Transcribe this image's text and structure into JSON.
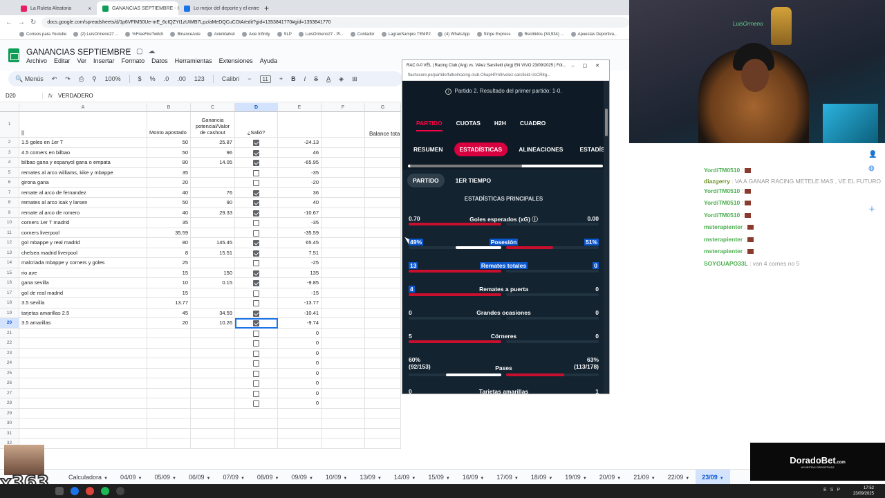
{
  "browser": {
    "tabs": [
      {
        "title": "La Ruleta Aleatoria",
        "color": "#e91e63"
      },
      {
        "title": "GANANCIAS SEPTIEMBRE - Hoj",
        "color": "#0f9d58",
        "active": true
      },
      {
        "title": "Lo mejor del deporte y el entre",
        "color": "#1a73e8"
      }
    ],
    "url": "docs.google.com/spreadsheets/d/1p6VFIM50Ue-mE_6cIQZYt1zUIMB7Lpz/aMeDQCuCOtA/edit?gid=1353841770#gid=1353841770",
    "bookmarks": [
      "Correos para Youtube",
      "(2) LuisOrmeno27 ...",
      "%FreeFireTwitch",
      "BinanceAxie",
      "AxieMarket",
      "Axie Infinity",
      "SLP",
      "LuisOrmeno27 - Pl...",
      "Contador",
      "LagranSampre TEMP2",
      "(4) WhatsApp",
      "Stripe Express",
      "Recibidos (34,934) ...",
      "Apuestas Deportiva..."
    ]
  },
  "sheets": {
    "title": "GANANCIAS SEPTIEMBRE",
    "menu": [
      "Archivo",
      "Editar",
      "Ver",
      "Insertar",
      "Formato",
      "Datos",
      "Herramientas",
      "Extensiones",
      "Ayuda"
    ],
    "toolbar": {
      "search": "Menús",
      "zoom": "100%",
      "currency": "$",
      "percent": "%",
      "dec_less": ".0",
      "dec_more": ".00",
      "format": "123",
      "font": "Calibri",
      "font_size": "11"
    },
    "cell_ref": "D20",
    "formula": "VERDADERO",
    "columns": [
      "A",
      "B",
      "C",
      "D",
      "E",
      "F",
      "G"
    ],
    "header_row": {
      "a": "||",
      "b": "Monto apostado",
      "c": "Ganancia potencial/Valor de cashout",
      "d": "¿Salió?",
      "g": "Balance tota"
    },
    "rows": [
      {
        "n": "2",
        "a": "1.5 goles en 1er T",
        "b": "50",
        "c": "25.87",
        "d": true,
        "e": "-24.13"
      },
      {
        "n": "3",
        "a": "4.5 corners en bilbao",
        "b": "50",
        "c": "96",
        "d": true,
        "e": "46"
      },
      {
        "n": "4",
        "a": "bilbao gana y espanyol gana o empata",
        "b": "80",
        "c": "14.05",
        "d": true,
        "e": "-65.95"
      },
      {
        "n": "5",
        "a": "remates al arco williams, kike y mbappe",
        "b": "35",
        "c": "",
        "d": false,
        "e": "-35"
      },
      {
        "n": "6",
        "a": "girona gana",
        "b": "20",
        "c": "",
        "d": false,
        "e": "-20"
      },
      {
        "n": "7",
        "a": "remate al arco de fernandez",
        "b": "40",
        "c": "76",
        "d": true,
        "e": "36"
      },
      {
        "n": "8",
        "a": "remates al arco isak y larsen",
        "b": "50",
        "c": "90",
        "d": true,
        "e": "40"
      },
      {
        "n": "9",
        "a": "remate al arco de romero",
        "b": "40",
        "c": "29.33",
        "d": true,
        "e": "-10.67"
      },
      {
        "n": "10",
        "a": "corners 1er T madrid",
        "b": "35",
        "c": "",
        "d": false,
        "e": "-35"
      },
      {
        "n": "11",
        "a": "corners liverpool",
        "b": "35.59",
        "c": "",
        "d": false,
        "e": "-35.59"
      },
      {
        "n": "12",
        "a": "gol mbappe y real madrid",
        "b": "80",
        "c": "145.45",
        "d": true,
        "e": "65.45"
      },
      {
        "n": "13",
        "a": "chelsea madrid liverpool",
        "b": "8",
        "c": "15.51",
        "d": true,
        "e": "7.51"
      },
      {
        "n": "14",
        "a": "malcriada mbappe y corners y goles",
        "b": "25",
        "c": "",
        "d": false,
        "e": "-25"
      },
      {
        "n": "15",
        "a": "rio ave",
        "b": "15",
        "c": "150",
        "d": true,
        "e": "135"
      },
      {
        "n": "16",
        "a": "gana sevilla",
        "b": "10",
        "c": "0.15",
        "d": true,
        "e": "-9.85"
      },
      {
        "n": "17",
        "a": "gol de real madrid",
        "b": "15",
        "c": "",
        "d": false,
        "e": "-15"
      },
      {
        "n": "18",
        "a": "3.5 sevilla",
        "b": "13.77",
        "c": "",
        "d": false,
        "e": "-13.77"
      },
      {
        "n": "19",
        "a": "tarjetas amarillas 2.5",
        "b": "45",
        "c": "34.59",
        "d": true,
        "e": "-10.41"
      },
      {
        "n": "20",
        "a": "3.5 amarillas",
        "b": "20",
        "c": "10.26",
        "d": true,
        "e": "-9.74",
        "selected": true
      },
      {
        "n": "21",
        "a": "",
        "b": "",
        "c": "",
        "d": false,
        "e": "0"
      },
      {
        "n": "22",
        "a": "",
        "b": "",
        "c": "",
        "d": false,
        "e": "0"
      },
      {
        "n": "23",
        "a": "",
        "b": "",
        "c": "",
        "d": false,
        "e": "0"
      },
      {
        "n": "24",
        "a": "",
        "b": "",
        "c": "",
        "d": false,
        "e": "0"
      },
      {
        "n": "25",
        "a": "",
        "b": "",
        "c": "",
        "d": false,
        "e": "0"
      },
      {
        "n": "26",
        "a": "",
        "b": "",
        "c": "",
        "d": false,
        "e": "0"
      },
      {
        "n": "27",
        "a": "",
        "b": "",
        "c": "",
        "d": false,
        "e": "0"
      },
      {
        "n": "28",
        "a": "",
        "b": "",
        "c": "",
        "d": false,
        "e": "0"
      },
      {
        "n": "29",
        "a": "",
        "b": "",
        "c": "",
        "d": null,
        "e": ""
      },
      {
        "n": "30",
        "a": "",
        "b": "",
        "c": "",
        "d": null,
        "e": ""
      },
      {
        "n": "31",
        "a": "",
        "b": "",
        "c": "",
        "d": null,
        "e": ""
      },
      {
        "n": "32",
        "a": "",
        "b": "",
        "c": "",
        "d": null,
        "e": ""
      },
      {
        "n": "33",
        "a": "",
        "b": "",
        "c": "",
        "d": null,
        "e": ""
      }
    ],
    "sheet_tabs": [
      "Calculadora",
      "04/09",
      "05/09",
      "06/09",
      "07/09",
      "08/09",
      "09/09",
      "10/09",
      "13/09",
      "14/09",
      "15/09",
      "16/09",
      "17/09",
      "18/09",
      "19/09",
      "20/09",
      "21/09",
      "22/09",
      "23/09"
    ],
    "active_tab": "23/09"
  },
  "popup": {
    "title": "RAC 0-0 VÉL | Racing Club (Arg) vs. Vélez Sarsfield (Arg) EN VIVO 23/09/2025 | Fút...",
    "url": "flashscore.pe/partido/futbol/racing-club-OhapHPm9/velez-sarsfield-UsCR8g...",
    "info": "Partido 2. Resultado del primer partido: 1-0.",
    "main_tabs": [
      "PARTIDO",
      "CUOTAS",
      "H2H",
      "CUADRO"
    ],
    "sub_tabs": [
      "RESUMEN",
      "ESTADÍSTICAS",
      "ALINEACIONES",
      "ESTADÍS"
    ],
    "period_tabs": [
      "PARTIDO",
      "1ER TIEMPO"
    ],
    "section_title": "ESTADÍSTICAS PRINCIPALES",
    "stats": [
      {
        "name": "Goles esperados (xG)",
        "left": "0.70",
        "right": "0.00",
        "lf": 1.0,
        "rf": 0.0,
        "info": true
      },
      {
        "name": "Posesión",
        "left": "49%",
        "right": "51%",
        "lf": 0.49,
        "rf": 0.51,
        "white": true,
        "hl": true
      },
      {
        "name": "Remates totales",
        "left": "13",
        "right": "0",
        "lf": 1.0,
        "rf": 0.0,
        "hl": true
      },
      {
        "name": "Remates a puerta",
        "left": "4",
        "right": "0",
        "lf": 1.0,
        "rf": 0.0,
        "hlLeft": true
      },
      {
        "name": "Grandes ocasiones",
        "left": "0",
        "right": "0",
        "lf": 0.0,
        "rf": 0.0
      },
      {
        "name": "Córneres",
        "left": "5",
        "right": "0",
        "lf": 1.0,
        "rf": 0.0
      },
      {
        "name": "Pases",
        "left": "60%",
        "left2": "(92/153)",
        "right": "63%",
        "right2": "(113/178)",
        "lf": 0.6,
        "rf": 0.63,
        "white": true
      },
      {
        "name": "Tarjetas amarillas",
        "left": "0",
        "right": "1",
        "lf": 0.0,
        "rf": 1.0
      }
    ]
  },
  "chat": [
    {
      "user": "YordiTM0510",
      "text": ":",
      "emote": true
    },
    {
      "user": "diazgerry",
      "text": ": VA A GANAR RACING METELE MAS , VE EL FUTURO"
    },
    {
      "user": "YordiTM0510",
      "text": ":",
      "emote": true
    },
    {
      "user": "YordiTM0510",
      "text": ":",
      "emote": true
    },
    {
      "user": "YordiTM0510",
      "text": ":",
      "emote": true
    },
    {
      "user": "msterapienter",
      "text": ":",
      "emote": true
    },
    {
      "user": "msterapienter",
      "text": ":",
      "emote": true
    },
    {
      "user": "msterapienter",
      "text": ":",
      "emote": true
    },
    {
      "user": "SOYGUAPO33L",
      "text": ": van 4 cornes no 5"
    }
  ],
  "cam_sign": "LuisOrmeno",
  "sponsor": {
    "name": "DoradoBet",
    "suffix": ".com",
    "tagline": "APUESTAS DEPORTIVAS"
  },
  "overlay_counter": "x363",
  "clock": {
    "time": "17:52",
    "date": "23/09/2025",
    "lang": "ESP"
  },
  "colors": {
    "accent": "#ff0046",
    "pill_active": "#d8003f",
    "home_bar": "#c8102e",
    "sheets_green": "#0f9d58",
    "selection": "#1a73e8"
  }
}
